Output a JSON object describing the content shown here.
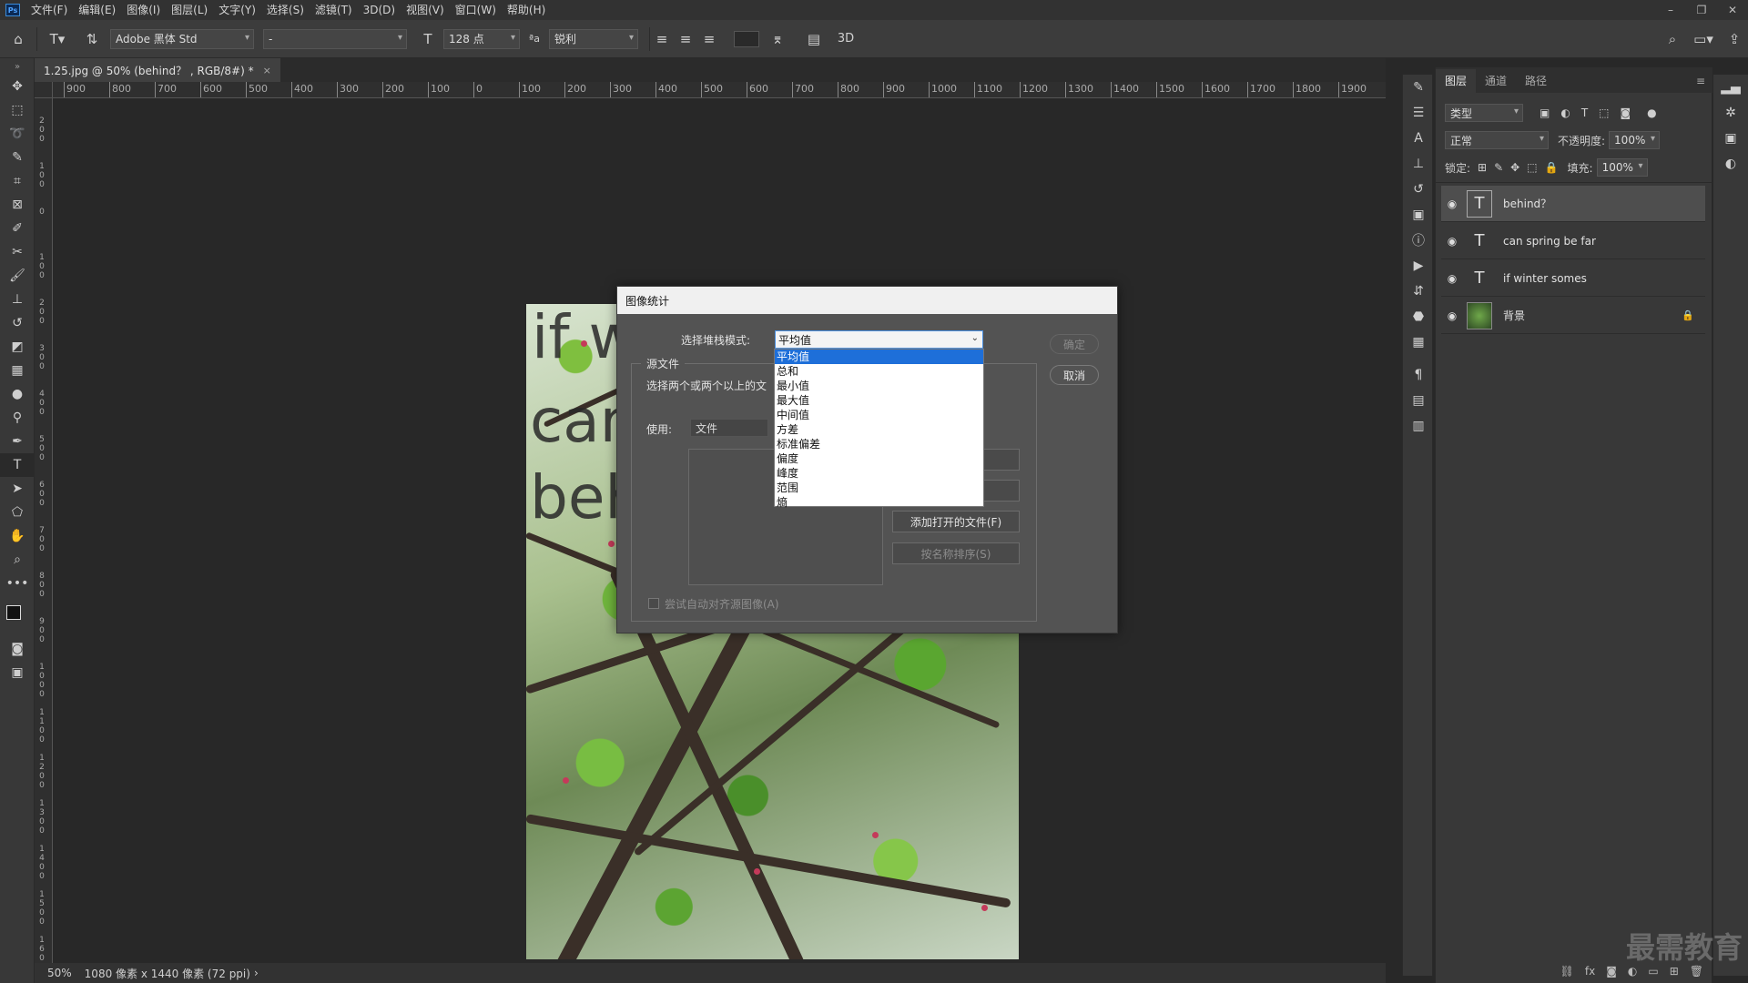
{
  "menubar": {
    "logo": "Ps",
    "items": [
      "文件(F)",
      "编辑(E)",
      "图像(I)",
      "图层(L)",
      "文字(Y)",
      "选择(S)",
      "滤镜(T)",
      "3D(D)",
      "视图(V)",
      "窗口(W)",
      "帮助(H)"
    ],
    "window_controls": [
      "–",
      "❐",
      "✕"
    ]
  },
  "options": {
    "font_family": "Adobe 黑体 Std",
    "font_style": "-",
    "font_size": "128 点",
    "aa_icon_text": "ªa",
    "antialias": "锐利",
    "threed": "3D"
  },
  "document": {
    "tab_title": "1.25.jpg @ 50% (behind？ , RGB/8#) *",
    "close_glyph": "×"
  },
  "ruler": {
    "h_labels": [
      "900",
      "800",
      "700",
      "600",
      "500",
      "400",
      "300",
      "200",
      "100",
      "0",
      "100",
      "200",
      "300",
      "400",
      "500",
      "600",
      "700",
      "800",
      "900",
      "1000",
      "1100",
      "1200",
      "1300",
      "1400",
      "1500",
      "1600",
      "1700",
      "1800",
      "1900"
    ],
    "v_labels": [
      "200",
      "100",
      "0",
      "100",
      "200",
      "300",
      "400",
      "500",
      "600",
      "700",
      "800",
      "900",
      "1000",
      "1100",
      "1200",
      "1300",
      "1400",
      "1500",
      "1600"
    ]
  },
  "canvas_text": {
    "line1": "if winter somes",
    "line2": "can s",
    "line3": "beh"
  },
  "dialog": {
    "title": "图像统计",
    "stack_mode_label": "选择堆栈模式:",
    "stack_mode_value": "平均值",
    "ok": "确定",
    "cancel": "取消",
    "source_group": "源文件",
    "source_desc": "选择两个或两个以上的文",
    "use_label": "使用:",
    "use_value": "文件",
    "add_open": "添加打开的文件(F)",
    "sort_by_name": "按名称排序(S)",
    "auto_align": "尝试自动对齐源图像(A)",
    "dropdown_options": [
      "平均值",
      "总和",
      "最小值",
      "最大值",
      "中间值",
      "方差",
      "标准偏差",
      "偏度",
      "峰度",
      "范围",
      "熵"
    ]
  },
  "status": {
    "zoom": "50%",
    "info": "1080 像素 x 1440 像素 (72 ppi)",
    "arrow": "›"
  },
  "layers_panel": {
    "tabs": [
      "图层",
      "通道",
      "路径"
    ],
    "filter_kind": "类型",
    "blend_mode": "正常",
    "opacity_label": "不透明度:",
    "opacity_value": "100%",
    "lock_label": "锁定:",
    "fill_label": "填充:",
    "fill_value": "100%",
    "layers": [
      {
        "name": "behind？",
        "type": "text"
      },
      {
        "name": "can spring be far",
        "type": "text"
      },
      {
        "name": "if winter somes",
        "type": "text"
      },
      {
        "name": "背景",
        "type": "image"
      }
    ]
  },
  "watermark": "最需教育"
}
